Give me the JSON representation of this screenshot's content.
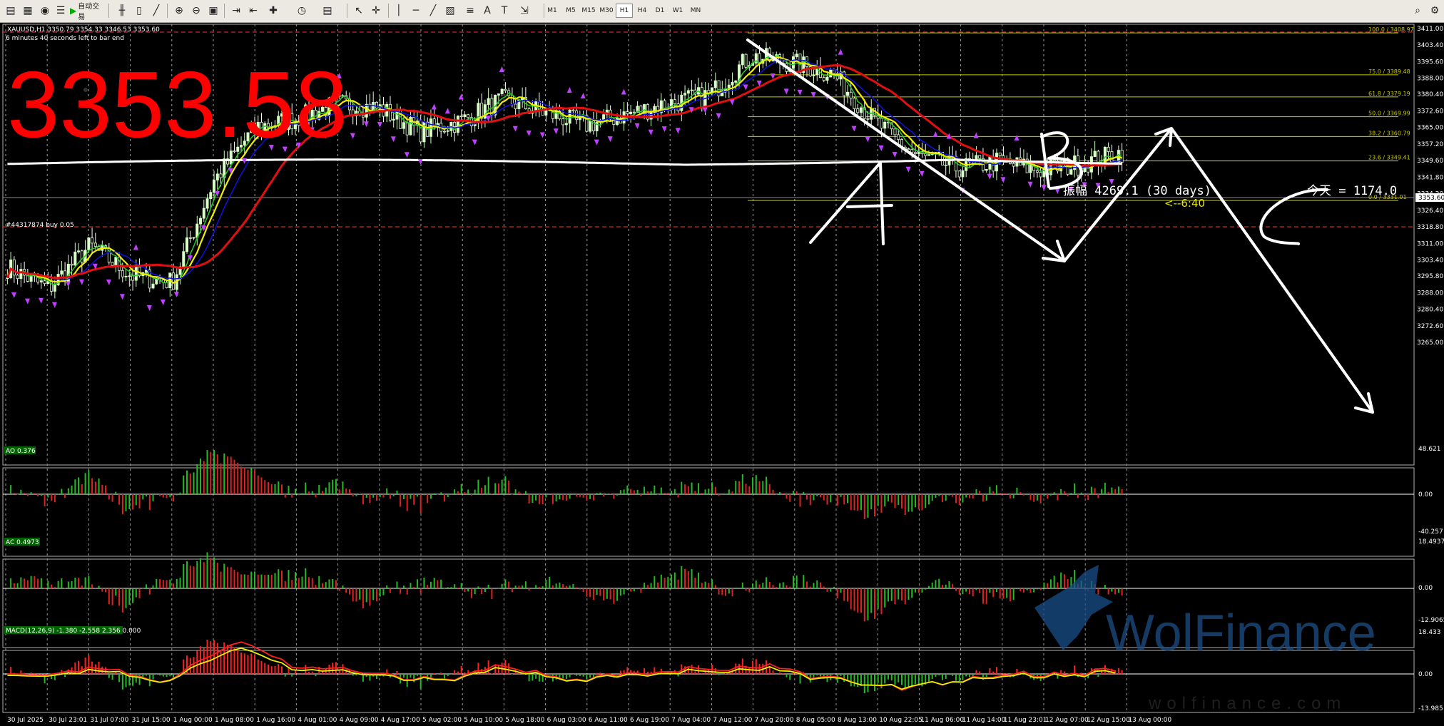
{
  "toolbar": {
    "auto_trade_label": "自动交易",
    "timeframes": [
      "M1",
      "M5",
      "M15",
      "M30",
      "H1",
      "H4",
      "D1",
      "W1",
      "MN"
    ],
    "active_timeframe": "H1"
  },
  "chart": {
    "symbol_info": "XAUUSD,H1  3350.79 3354.33 3346.53 3353.60",
    "timer_text": "6 minutes 40 seconds left to bar end",
    "big_price": "3353.58",
    "order_label": "#44317874 buy 0.05",
    "countdown_label": "<--6:40",
    "amplitude_label": "振幅 4269.1  (30 days)",
    "today_label": "今天 = 1174.0",
    "price_axis": [
      "3411.00",
      "3403.40",
      "3395.60",
      "3388.00",
      "3380.40",
      "3372.60",
      "3365.00",
      "3357.20",
      "3349.60",
      "3341.80",
      "3334.20",
      "3326.40",
      "3318.80",
      "3311.00",
      "3303.40",
      "3295.80",
      "3288.00",
      "3280.40",
      "3272.60",
      "3265.00"
    ],
    "current_price_tag": "3353.60",
    "fib_levels": [
      {
        "label": "100.0 / 3408.97",
        "price": 3408.97
      },
      {
        "label": "75.0 / 3389.48",
        "price": 3389.48
      },
      {
        "label": "61.8 / 3379.19",
        "price": 3379.19
      },
      {
        "label": "50.0 / 3369.99",
        "price": 3369.99
      },
      {
        "label": "38.2 / 3360.79",
        "price": 3360.79
      },
      {
        "label": "23.6 / 3349.41",
        "price": 3349.41
      },
      {
        "label": "0.0 / 3331.01",
        "price": 3331.01
      }
    ],
    "time_axis": [
      "30 Jul 2025",
      "30 Jul 23:01",
      "31 Jul 07:00",
      "31 Jul 15:00",
      "1 Aug 00:00",
      "1 Aug 08:00",
      "1 Aug 16:00",
      "4 Aug 01:00",
      "4 Aug 09:00",
      "4 Aug 17:00",
      "5 Aug 02:00",
      "5 Aug 10:00",
      "5 Aug 18:00",
      "6 Aug 03:00",
      "6 Aug 11:00",
      "6 Aug 19:00",
      "7 Aug 04:00",
      "7 Aug 12:00",
      "7 Aug 20:00",
      "8 Aug 05:00",
      "8 Aug 13:00",
      "10 Aug 22:05",
      "11 Aug 06:00",
      "11 Aug 14:00",
      "11 Aug 23:01",
      "12 Aug 07:00",
      "12 Aug 15:00",
      "13 Aug 00:00"
    ],
    "wave_labels": [
      "A",
      "B",
      "C"
    ]
  },
  "indicators": {
    "ao": {
      "label": "AO 0.376",
      "scale_top": "48.621",
      "scale_mid": "0.00",
      "scale_bottom": "-40.257"
    },
    "ac": {
      "label": "AC 0.4973",
      "scale_top": "18.4937",
      "scale_mid": "0.00",
      "scale_bottom": "-12.9065"
    },
    "macd": {
      "label": "MACD(12,26,9) -1.380 -2.558 2.356 0.000",
      "scale_top": "18.433",
      "scale_mid": "0.00",
      "scale_bottom": "-13.985"
    }
  },
  "watermark": {
    "brand": "WolFinance",
    "url": "wolfinance.com"
  },
  "colors": {
    "up_bar": "#22bb22",
    "down_bar": "#dd2222",
    "fib": "#c8c800",
    "ma_red": "#e01010",
    "ma_yellow": "#f0f000",
    "ma_green": "#22cc22",
    "ma_blue": "#1010e0",
    "ma_white": "#ffffff",
    "big_price": "#ff0000"
  },
  "chart_data": {
    "type": "candlestick",
    "x": [
      "30 Jul 2025",
      "30 Jul 23:01",
      "31 Jul 07:00",
      "31 Jul 15:00",
      "1 Aug 00:00",
      "1 Aug 08:00",
      "1 Aug 16:00",
      "4 Aug 01:00",
      "4 Aug 09:00",
      "4 Aug 17:00",
      "5 Aug 02:00",
      "5 Aug 10:00",
      "5 Aug 18:00",
      "6 Aug 03:00",
      "6 Aug 11:00",
      "6 Aug 19:00",
      "7 Aug 04:00",
      "7 Aug 12:00",
      "7 Aug 20:00",
      "8 Aug 05:00",
      "8 Aug 13:00",
      "10 Aug 22:05",
      "11 Aug 06:00",
      "11 Aug 14:00",
      "11 Aug 23:01",
      "12 Aug 07:00",
      "12 Aug 15:00",
      "13 Aug 00:00"
    ],
    "close": [
      3300,
      3290,
      3310,
      3296,
      3293,
      3340,
      3365,
      3369,
      3376,
      3374,
      3363,
      3368,
      3378,
      3372,
      3366,
      3371,
      3376,
      3380,
      3398,
      3395,
      3390,
      3368,
      3352,
      3346,
      3349,
      3345,
      3348,
      3353.6
    ],
    "ylim": [
      3265.0,
      3411.0
    ]
  }
}
